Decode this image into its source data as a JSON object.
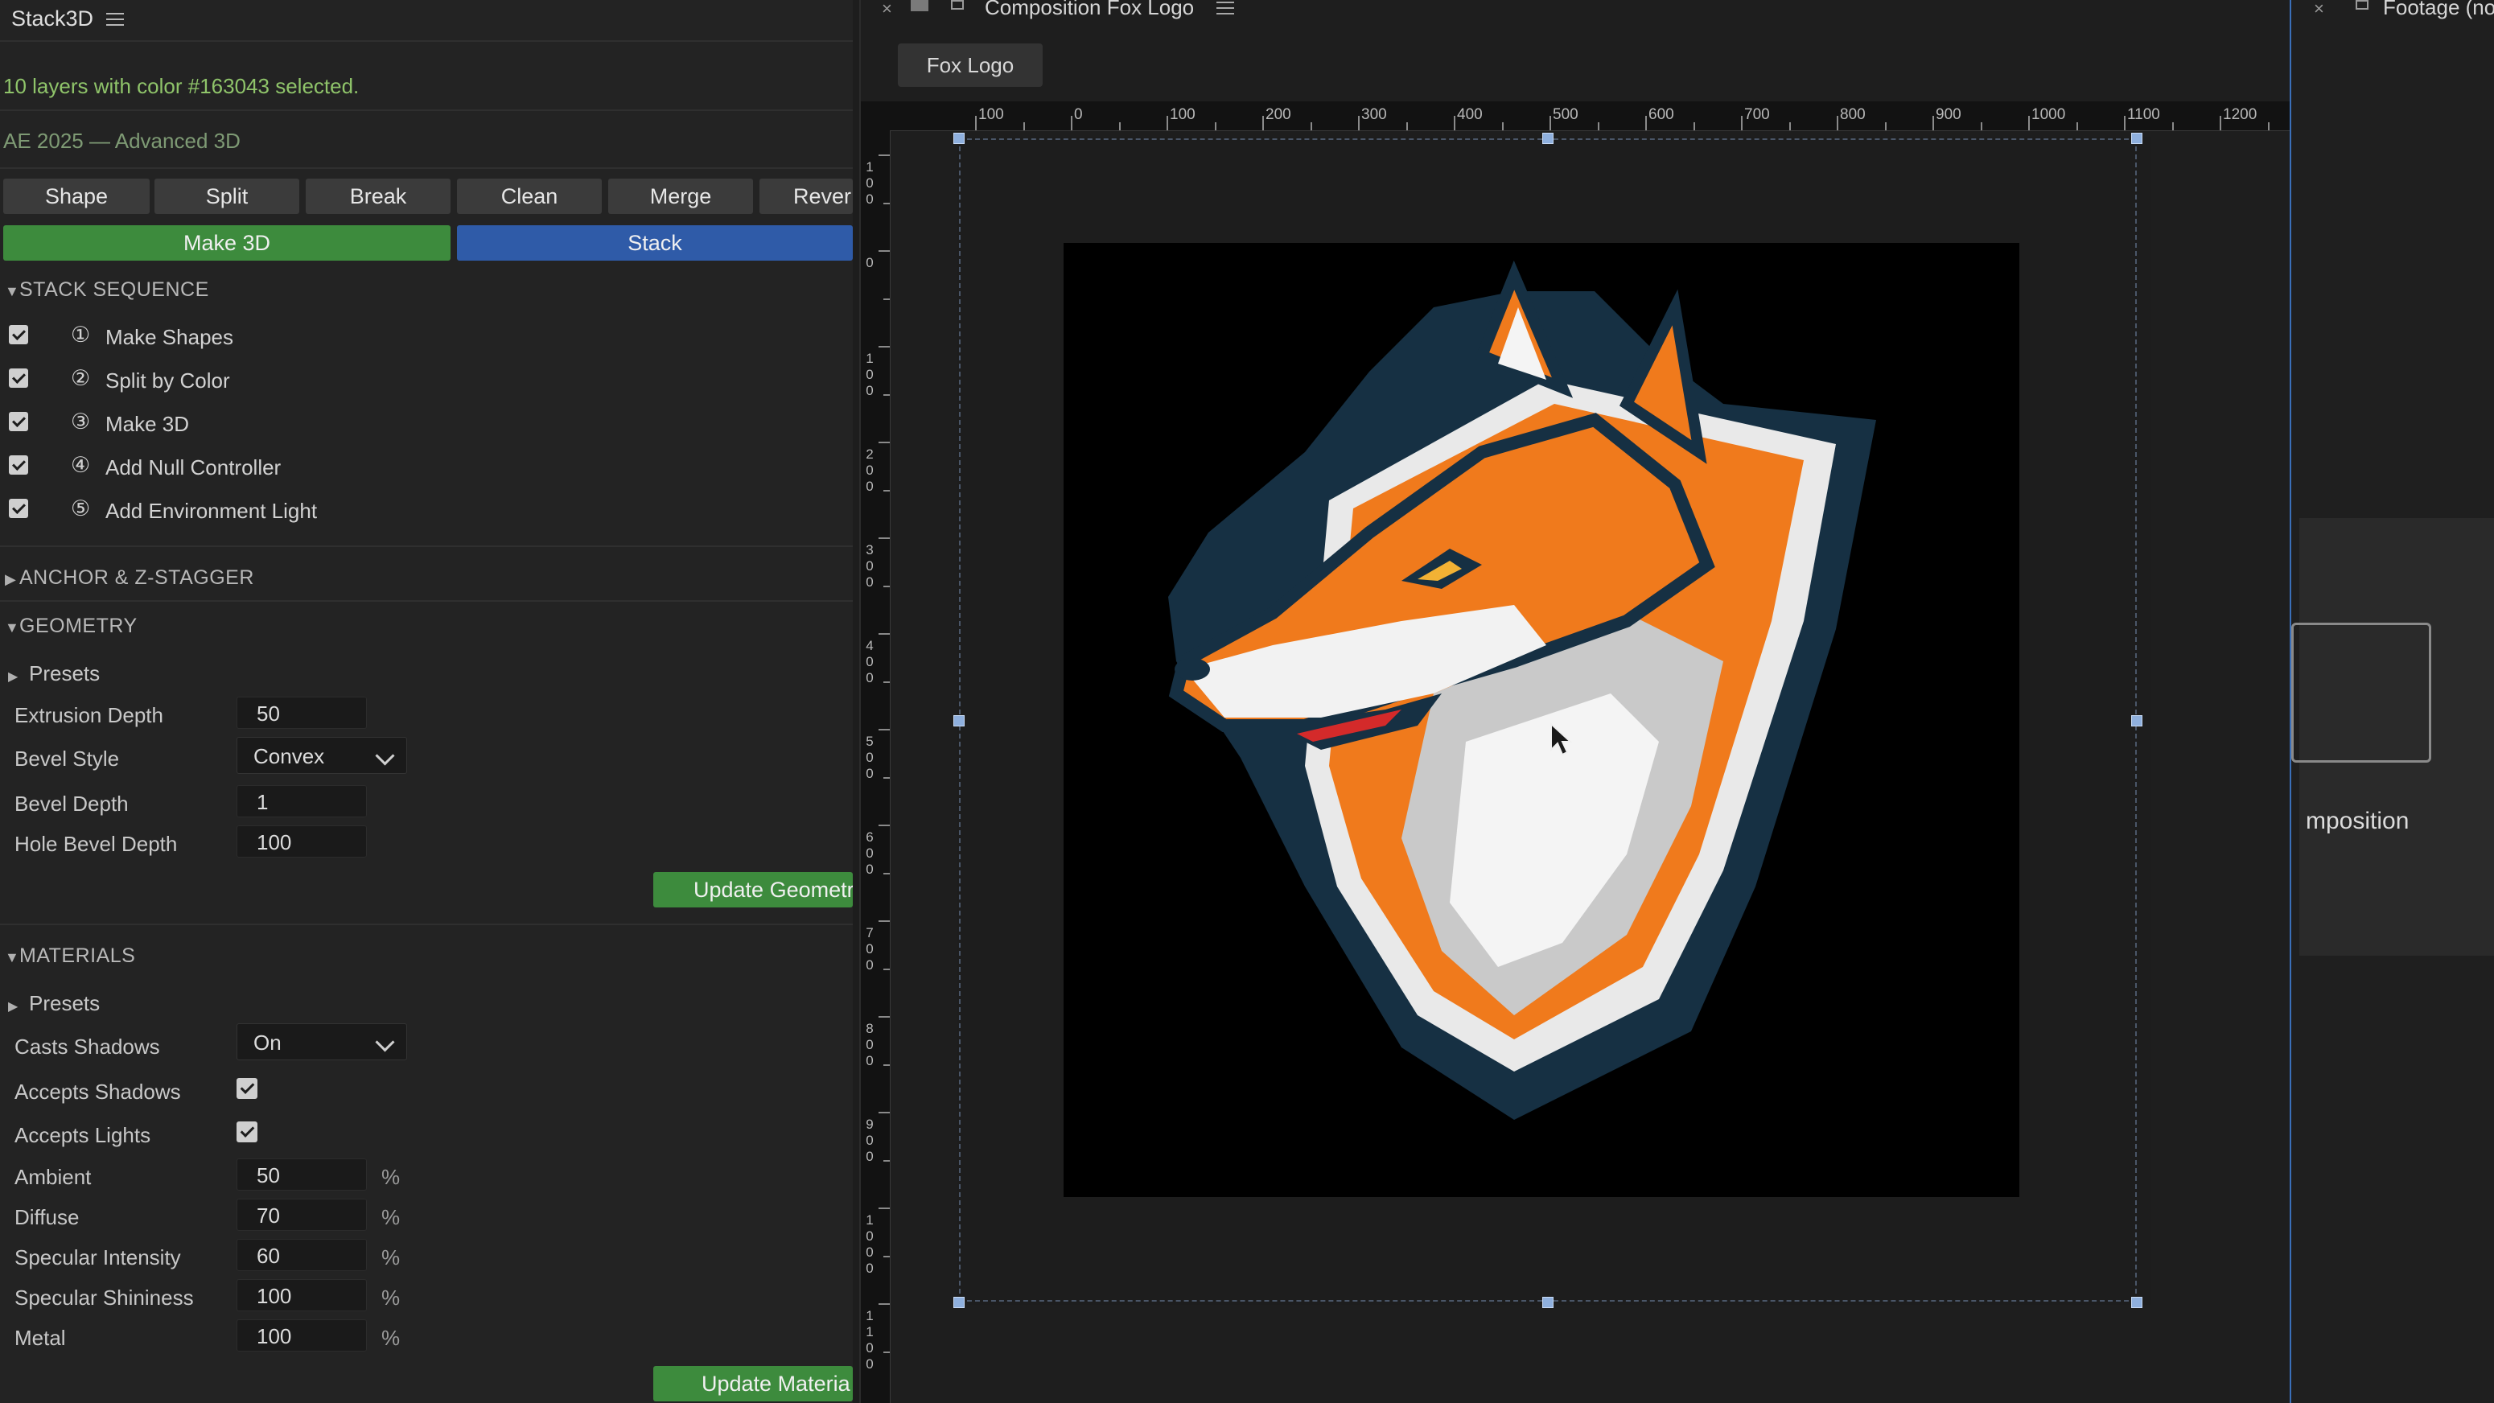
{
  "left_panel": {
    "title": "Stack3D",
    "status": "10 layers with color #163043 selected.",
    "version": "AE 2025 — Advanced 3D",
    "toolbar": {
      "row1": [
        "Shape",
        "Split",
        "Break",
        "Clean",
        "Merge",
        "Rever"
      ],
      "make3d": "Make 3D",
      "stack": "Stack"
    },
    "stack_sequence": {
      "title": "STACK SEQUENCE",
      "items": [
        {
          "num": "①",
          "label": "Make Shapes",
          "checked": true
        },
        {
          "num": "②",
          "label": "Split by Color",
          "checked": true
        },
        {
          "num": "③",
          "label": "Make 3D",
          "checked": true
        },
        {
          "num": "④",
          "label": "Add Null Controller",
          "checked": true
        },
        {
          "num": "⑤",
          "label": "Add Environment Light",
          "checked": true
        }
      ]
    },
    "anchor_section": "ANCHOR & Z-STAGGER",
    "geometry": {
      "title": "GEOMETRY",
      "presets": "Presets",
      "extrusion_depth": {
        "label": "Extrusion Depth",
        "value": "50"
      },
      "bevel_style": {
        "label": "Bevel Style",
        "value": "Convex"
      },
      "bevel_depth": {
        "label": "Bevel Depth",
        "value": "1"
      },
      "hole_bevel_depth": {
        "label": "Hole Bevel Depth",
        "value": "100"
      },
      "update_button": "Update Geometr"
    },
    "materials": {
      "title": "MATERIALS",
      "presets": "Presets",
      "casts_shadows": {
        "label": "Casts Shadows",
        "value": "On"
      },
      "accepts_shadows": {
        "label": "Accepts Shadows",
        "checked": true
      },
      "accepts_lights": {
        "label": "Accepts Lights",
        "checked": true
      },
      "ambient": {
        "label": "Ambient",
        "value": "50",
        "unit": "%"
      },
      "diffuse": {
        "label": "Diffuse",
        "value": "70",
        "unit": "%"
      },
      "specular_intensity": {
        "label": "Specular Intensity",
        "value": "60",
        "unit": "%"
      },
      "specular_shininess": {
        "label": "Specular Shininess",
        "value": "100",
        "unit": "%"
      },
      "metal": {
        "label": "Metal",
        "value": "100",
        "unit": "%"
      },
      "update_button": "Update Materia"
    }
  },
  "composition": {
    "tab_title": "Composition Fox Logo",
    "comp_chip": "Fox Logo",
    "h_ruler_labels": [
      "100",
      "0",
      "100",
      "200",
      "300",
      "400",
      "500",
      "600",
      "700",
      "800",
      "900",
      "1000",
      "1100",
      "1200"
    ],
    "v_ruler_labels": [
      "100",
      "0",
      "100",
      "200",
      "300",
      "400",
      "500",
      "600",
      "700",
      "800",
      "900",
      "1000",
      "1100"
    ]
  },
  "right_panel": {
    "tab_title": "Footage (no",
    "text": "mposition"
  },
  "colors": {
    "accent_green": "#3d8b3d",
    "accent_blue": "#2f5ba8",
    "fox_orange": "#f07a1c",
    "fox_navy": "#163043"
  }
}
